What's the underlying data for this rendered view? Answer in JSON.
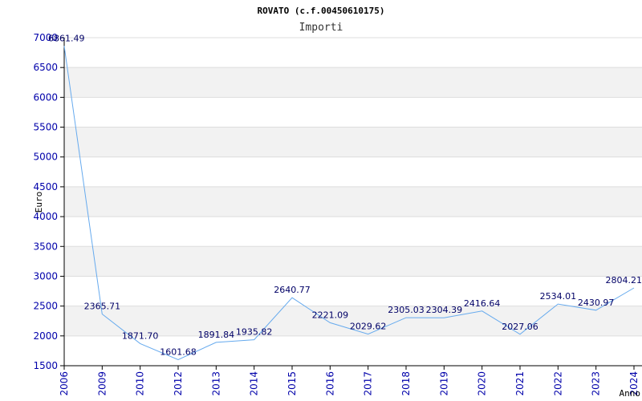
{
  "chart_data": {
    "type": "line",
    "title": "ROVATO (c.f.00450610175)",
    "subtitle": "Importi",
    "xlabel": "Anno",
    "ylabel": "Euro",
    "ylim": [
      1500,
      7000
    ],
    "yticks": [
      1500,
      2000,
      2500,
      3000,
      3500,
      4000,
      4500,
      5000,
      5500,
      6000,
      6500,
      7000
    ],
    "categories": [
      "2006",
      "2009",
      "2010",
      "2012",
      "2013",
      "2014",
      "2015",
      "2016",
      "2017",
      "2018",
      "2019",
      "2020",
      "2021",
      "2022",
      "2023",
      "2024"
    ],
    "values": [
      6861.49,
      2365.71,
      1871.7,
      1601.68,
      1891.84,
      1935.82,
      2640.77,
      2221.09,
      2029.62,
      2305.03,
      2304.39,
      2416.64,
      2027.06,
      2534.01,
      2430.97,
      2804.21
    ],
    "data_labels": [
      "6861.49",
      "2365.71",
      "1871.70",
      "1601.68",
      "1891.84",
      "1935.82",
      "2640.77",
      "2221.09",
      "2029.62",
      "2305.03",
      "2304.39",
      "2416.64",
      "2027.06",
      "2534.01",
      "2430.97",
      "2804.21"
    ],
    "grid": true,
    "colors": {
      "line": "#66aaee",
      "band": "#f2f2f2",
      "grid": "#dddddd",
      "axis": "#000000",
      "tick_text": "#0000aa",
      "data_label": "#000066"
    }
  }
}
